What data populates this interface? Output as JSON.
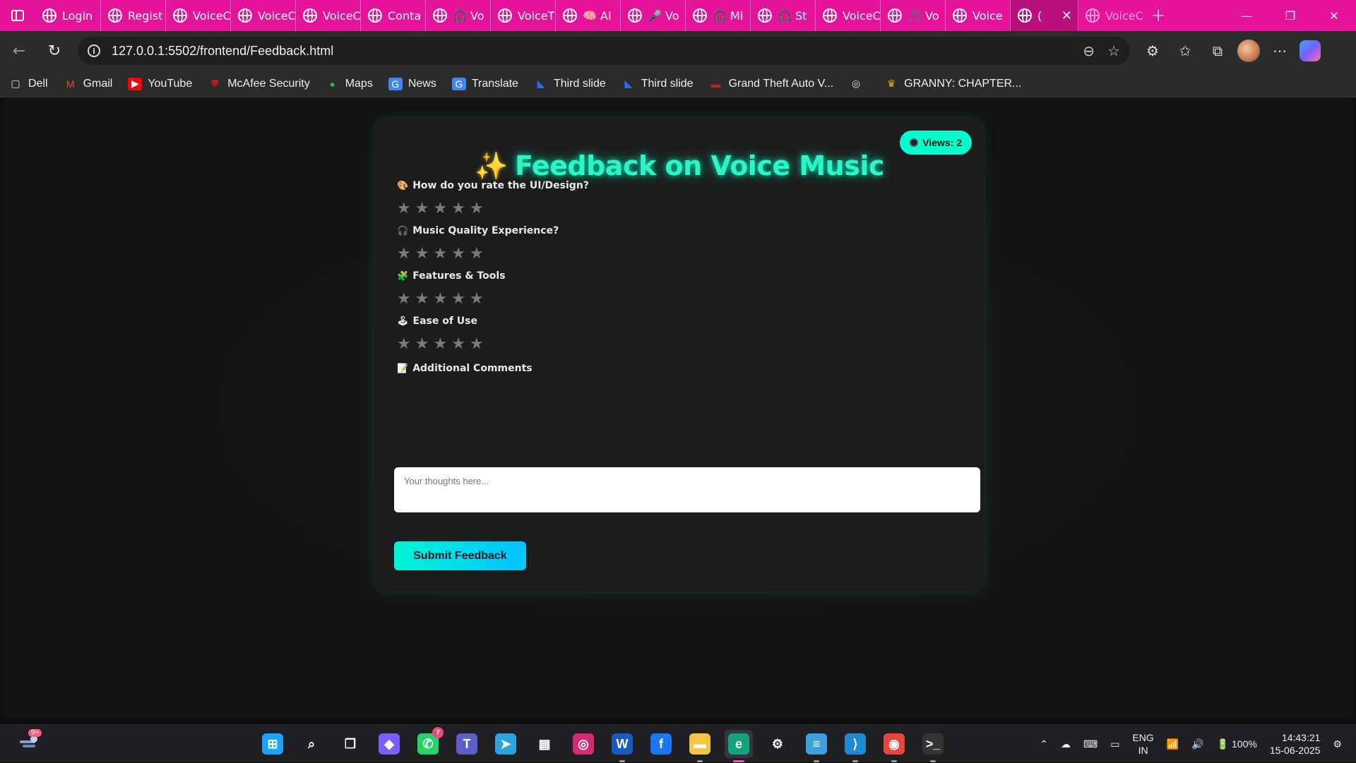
{
  "browser": {
    "tabs": [
      {
        "label": "Login",
        "icon": "globe-icon"
      },
      {
        "label": "Regist",
        "icon": "globe-icon"
      },
      {
        "label": "VoiceC",
        "icon": "globe-icon"
      },
      {
        "label": "VoiceC",
        "icon": "globe-icon"
      },
      {
        "label": "VoiceC",
        "icon": "globe-icon"
      },
      {
        "label": "Conta",
        "icon": "globe-icon"
      },
      {
        "label": "🎧 Vo",
        "icon": "globe-icon"
      },
      {
        "label": "VoiceT",
        "icon": "globe-icon"
      },
      {
        "label": "🧠 AI",
        "icon": "globe-icon"
      },
      {
        "label": "🎤 Vo",
        "icon": "globe-icon"
      },
      {
        "label": "🎧 Mi",
        "icon": "globe-icon"
      },
      {
        "label": "🎧 St",
        "icon": "globe-icon"
      },
      {
        "label": "VoiceC",
        "icon": "globe-icon"
      },
      {
        "label": "🎵 Vo",
        "icon": "globe-icon"
      },
      {
        "label": "Voice",
        "icon": "globe-icon"
      },
      {
        "label": "(",
        "icon": "globe-icon",
        "active": true
      },
      {
        "label": "VoiceC",
        "icon": "globe-icon"
      }
    ],
    "new_tab_label": "+",
    "window_controls": {
      "minimize": "—",
      "restore": "❐",
      "close": "✕"
    },
    "url": "127.0.0.1:5502/frontend/Feedback.html",
    "bookmarks": [
      {
        "label": "Dell",
        "icon": "folder-icon"
      },
      {
        "label": "Gmail",
        "icon": "gmail-icon"
      },
      {
        "label": "YouTube",
        "icon": "youtube-icon"
      },
      {
        "label": "McAfee Security",
        "icon": "mcafee-icon"
      },
      {
        "label": "Maps",
        "icon": "maps-icon"
      },
      {
        "label": "News",
        "icon": "news-icon"
      },
      {
        "label": "Translate",
        "icon": "translate-icon"
      },
      {
        "label": "Third slide",
        "icon": "bootstrap-icon"
      },
      {
        "label": "Third slide",
        "icon": "bootstrap-icon"
      },
      {
        "label": "Grand Theft Auto V...",
        "icon": "gamepad-icon"
      },
      {
        "label": "",
        "icon": "globe-icon"
      },
      {
        "label": "GRANNY: CHAPTER...",
        "icon": "crown-icon"
      }
    ]
  },
  "page": {
    "views_badge": "Views: 2",
    "title_spark": "✨",
    "title": "Feedback on Voice Music",
    "accent_color": "#00ffcc",
    "questions": [
      {
        "icon": "🎨",
        "label": "How do you rate the UI/Design?",
        "stars": 5,
        "selected": 0
      },
      {
        "icon": "🎧",
        "label": "Music Quality Experience?",
        "stars": 5,
        "selected": 0
      },
      {
        "icon": "🧩",
        "label": "Features & Tools",
        "stars": 5,
        "selected": 0
      },
      {
        "icon": "🕹",
        "label": "Ease of Use",
        "stars": 5,
        "selected": 0
      }
    ],
    "comments": {
      "icon": "📝",
      "label": "Additional Comments",
      "placeholder": "Your thoughts here...",
      "value": ""
    },
    "submit_label": "Submit Feedback"
  },
  "taskbar": {
    "notification_badge": "9+",
    "apps": [
      {
        "name": "windows-start-icon"
      },
      {
        "name": "search-icon"
      },
      {
        "name": "task-view-icon"
      },
      {
        "name": "copilot-icon"
      },
      {
        "name": "whatsapp-icon",
        "badge": "7"
      },
      {
        "name": "teams-icon"
      },
      {
        "name": "telegram-icon"
      },
      {
        "name": "store-icon"
      },
      {
        "name": "instagram-icon"
      },
      {
        "name": "word-icon",
        "running": true
      },
      {
        "name": "facebook-icon"
      },
      {
        "name": "file-explorer-icon",
        "running": true
      },
      {
        "name": "edge-icon",
        "active": true
      },
      {
        "name": "settings-icon"
      },
      {
        "name": "notepad-icon",
        "running": true
      },
      {
        "name": "vscode-icon",
        "running": true
      },
      {
        "name": "chrome-icon",
        "running": true
      },
      {
        "name": "terminal-icon",
        "running": true
      }
    ],
    "tray": {
      "lang_line1": "ENG",
      "lang_line2": "IN",
      "battery": "100%",
      "time": "14:43:21",
      "date": "15-06-2025"
    }
  }
}
